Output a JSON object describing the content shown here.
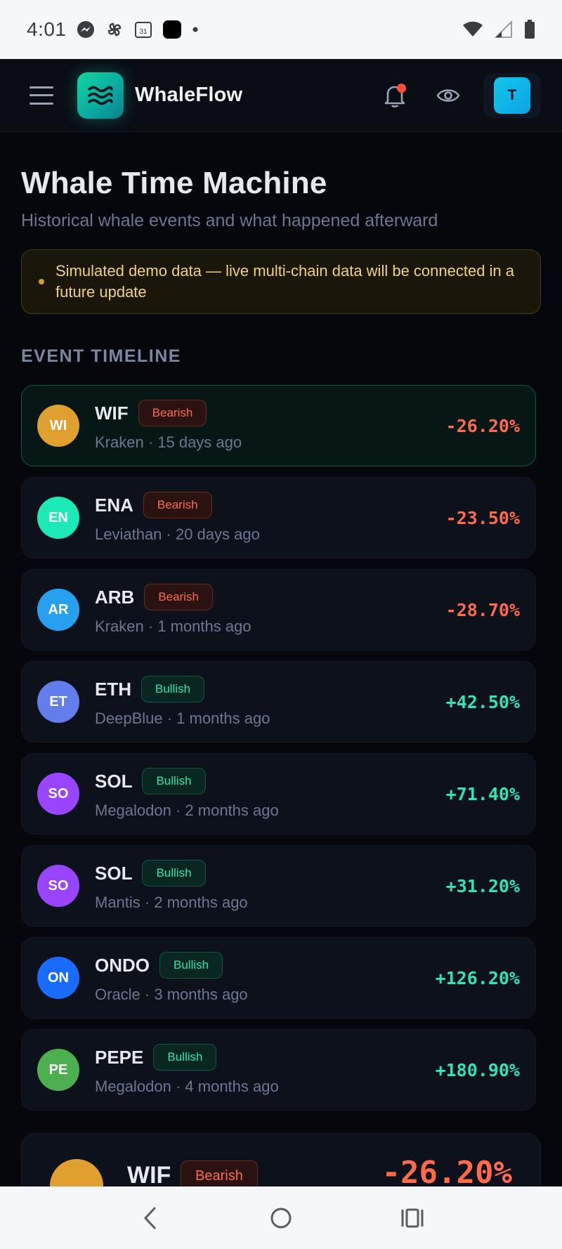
{
  "status_bar": {
    "time": "4:01",
    "calendar_day": "31"
  },
  "app": {
    "brand": "WhaleFlow",
    "avatar_initial": "T"
  },
  "page": {
    "title": "Whale Time Machine",
    "subtitle": "Historical whale events and what happened afterward"
  },
  "notice": {
    "text": "Simulated demo data — live multi-chain data will be connected in a future update"
  },
  "timeline": {
    "section_label": "EVENT TIMELINE",
    "events": [
      {
        "initials": "WI",
        "ticker": "WIF",
        "sentiment": "Bearish",
        "meta": "Kraken · 15 days ago",
        "change": "-26.20%",
        "coin_color": "#e0a030",
        "active": true
      },
      {
        "initials": "EN",
        "ticker": "ENA",
        "sentiment": "Bearish",
        "meta": "Leviathan · 20 days ago",
        "change": "-23.50%",
        "coin_color": "#1de9b6"
      },
      {
        "initials": "AR",
        "ticker": "ARB",
        "sentiment": "Bearish",
        "meta": "Kraken · 1 months ago",
        "change": "-28.70%",
        "coin_color": "#28a0f0"
      },
      {
        "initials": "ET",
        "ticker": "ETH",
        "sentiment": "Bullish",
        "meta": "DeepBlue · 1 months ago",
        "change": "+42.50%",
        "coin_color": "#627eea"
      },
      {
        "initials": "SO",
        "ticker": "SOL",
        "sentiment": "Bullish",
        "meta": "Megalodon · 2 months ago",
        "change": "+71.40%",
        "coin_color": "#9945ff"
      },
      {
        "initials": "SO",
        "ticker": "SOL",
        "sentiment": "Bullish",
        "meta": "Mantis · 2 months ago",
        "change": "+31.20%",
        "coin_color": "#9945ff"
      },
      {
        "initials": "ON",
        "ticker": "ONDO",
        "sentiment": "Bullish",
        "meta": "Oracle · 3 months ago",
        "change": "+126.20%",
        "coin_color": "#1a6bff"
      },
      {
        "initials": "PE",
        "ticker": "PEPE",
        "sentiment": "Bullish",
        "meta": "Megalodon · 4 months ago",
        "change": "+180.90%",
        "coin_color": "#4caf50"
      }
    ]
  },
  "detail": {
    "ticker": "WIF",
    "sentiment": "Bearish",
    "change": "-26.20%"
  },
  "colors": {
    "bearish": "#ff6b4a",
    "bullish": "#2ee6b0",
    "accent": "#10d6a2"
  }
}
